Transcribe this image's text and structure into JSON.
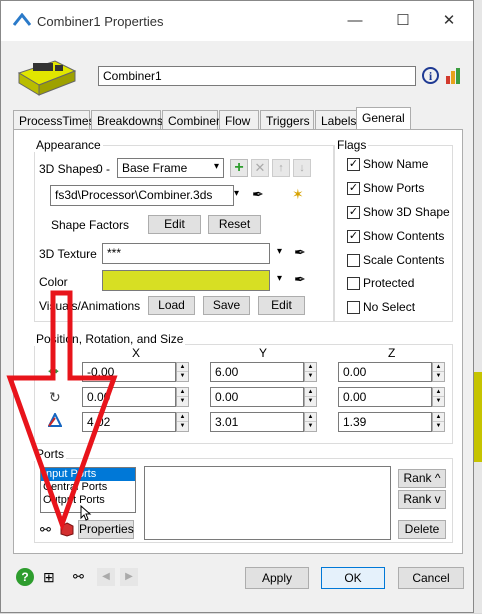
{
  "window": {
    "title": "Combiner1  Properties",
    "name_value": "Combiner1"
  },
  "tabs": [
    "ProcessTimes",
    "Breakdowns",
    "Combiner",
    "Flow",
    "Triggers",
    "Labels",
    "General"
  ],
  "appearance": {
    "group_label": "Appearance",
    "shapes_label": "3D Shapes",
    "shape_index": "0 -",
    "shape_select": "Base Frame",
    "shape_path": "fs3d\\Processor\\Combiner.3ds",
    "shape_factors_label": "Shape Factors",
    "edit_label": "Edit",
    "reset_label": "Reset",
    "texture_label": "3D Texture",
    "texture_value": "***",
    "color_label": "Color",
    "color_value": "#d7df23",
    "visuals_label": "Visuals/Animations",
    "load_label": "Load",
    "save_label": "Save",
    "edit2_label": "Edit"
  },
  "flags": {
    "group_label": "Flags",
    "items": [
      {
        "label": "Show Name",
        "checked": "✓"
      },
      {
        "label": "Show Ports",
        "checked": "✓"
      },
      {
        "label": "Show 3D Shape",
        "checked": "✓"
      },
      {
        "label": "Show Contents",
        "checked": "✓"
      },
      {
        "label": "Scale Contents",
        "checked": ""
      },
      {
        "label": "Protected",
        "checked": ""
      },
      {
        "label": "No Select",
        "checked": ""
      }
    ]
  },
  "position": {
    "group_label": "Position, Rotation, and Size",
    "headers": [
      "X",
      "Y",
      "Z"
    ],
    "rows": [
      [
        "-0.00",
        "6.00",
        "0.00"
      ],
      [
        "0.00",
        "0.00",
        "0.00"
      ],
      [
        "4.02",
        "3.01",
        "1.39"
      ]
    ]
  },
  "ports": {
    "group_label": "Ports",
    "list": [
      "Input Ports",
      "Central Ports",
      "Output Ports"
    ],
    "properties_label": "Properties",
    "rank_up_label": "Rank ^",
    "rank_down_label": "Rank v",
    "delete_label": "Delete"
  },
  "footer": {
    "apply_label": "Apply",
    "ok_label": "OK",
    "cancel_label": "Cancel"
  },
  "colors": {
    "selection": "#0078d7",
    "annotation": "#e8141b"
  }
}
